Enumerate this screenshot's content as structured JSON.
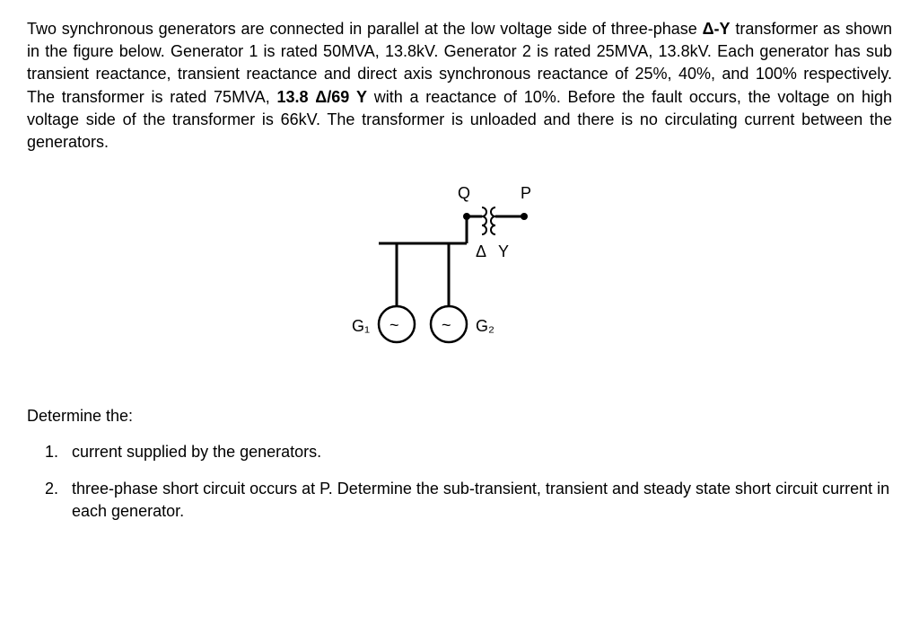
{
  "problem": {
    "intro": "Two synchronous generators are connected in parallel at the low voltage side of three-phase ",
    "deltaY1": "Δ-Y",
    "intro2": " transformer as shown in the figure below. Generator 1 is rated 50MVA, 13.8kV. Generator 2 is rated 25MVA, 13.8kV. Each generator has sub transient reactance, transient reactance and direct axis synchronous reactance of 25%, 40%, and 100% respectively. The transformer is rated 75MVA, ",
    "voltRating": "13.8 Δ/69 Y",
    "intro3": " with a reactance of 10%. Before the fault occurs, the voltage on high voltage side of the transformer is 66kV. The transformer is unloaded and there is no circulating current between the generators."
  },
  "figure": {
    "labelQ": "Q",
    "labelP": "P",
    "labelDelta": "Δ",
    "labelY": "Y",
    "labelG1": "G₁",
    "labelG2": "G₂",
    "genSymbol": "~"
  },
  "determine_label": "Determine the:",
  "questions": {
    "q1": "current supplied by the generators.",
    "q2": "three-phase short circuit occurs at P. Determine the sub-transient, transient and steady state short circuit current in each generator."
  }
}
